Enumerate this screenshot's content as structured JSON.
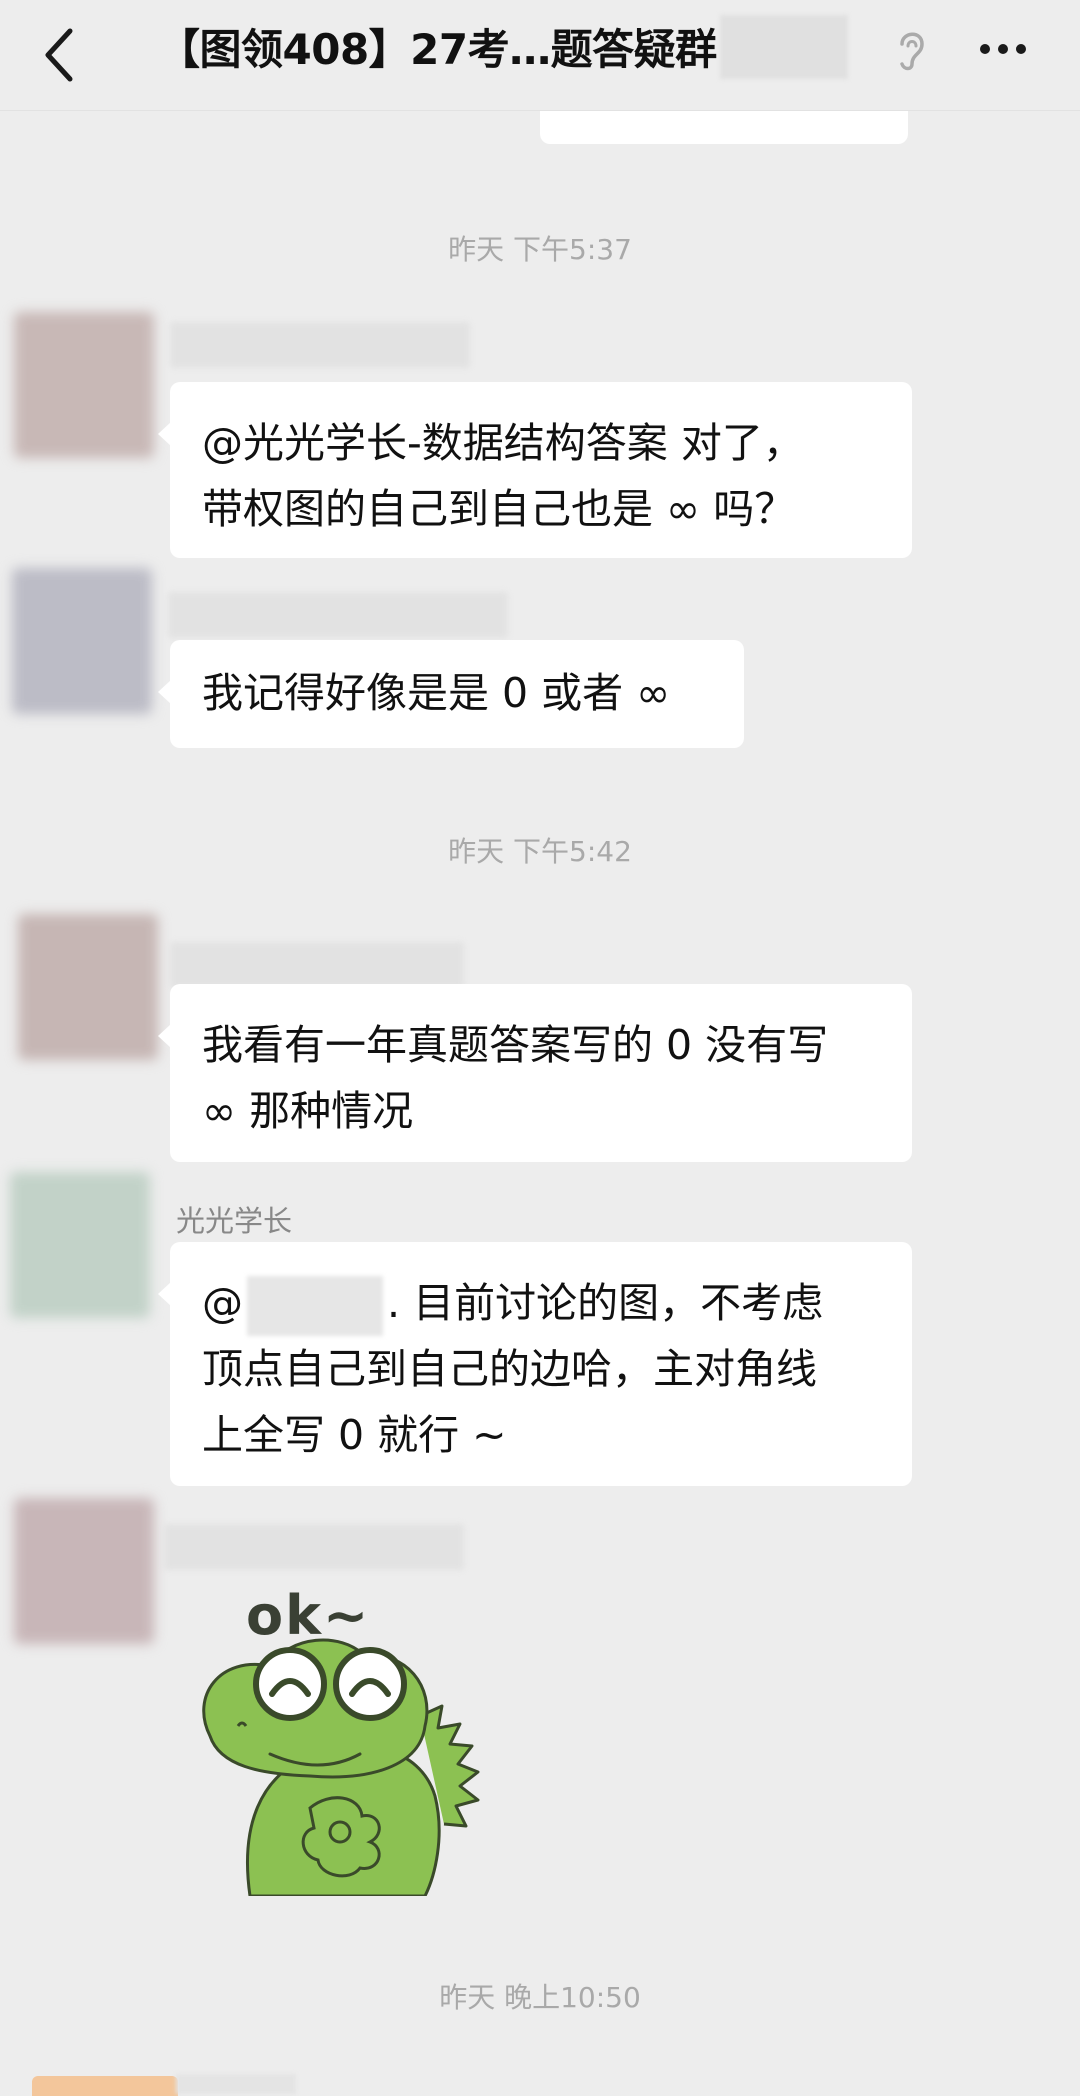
{
  "header": {
    "title": "【图领408】27考…题答疑群",
    "back_icon": "chevron-left-icon",
    "ear_icon": "ear-icon",
    "more_icon": "more-icon"
  },
  "timestamps": [
    "昨天 下午5:37",
    "昨天 下午5:42",
    "昨天 晚上10:50"
  ],
  "messages": [
    {
      "lines": [
        "@光光学长-数据结构答案  对了，",
        "带权图的自己到自己也是 ∞ 吗？"
      ]
    },
    {
      "lines": [
        "我记得好像是是 0 或者 ∞"
      ]
    },
    {
      "lines": [
        "我看有一年真题答案写的 0 没有写",
        "∞ 那种情况"
      ]
    },
    {
      "sender": "光光学长",
      "line1_prefix": "@",
      "line1_suffix": ". 目前讨论的图，不考虑",
      "lines_rest": [
        "顶点自己到自己的边哈，主对角线",
        "上全写 0 就行 ~"
      ]
    },
    {
      "sticker": "frog-sticker",
      "sticker_text": "ok~"
    }
  ],
  "colors": {
    "background": "#ededed",
    "bubble": "#ffffff",
    "timestamp": "#a9a9a9",
    "sticker_green": "#8cc152"
  }
}
